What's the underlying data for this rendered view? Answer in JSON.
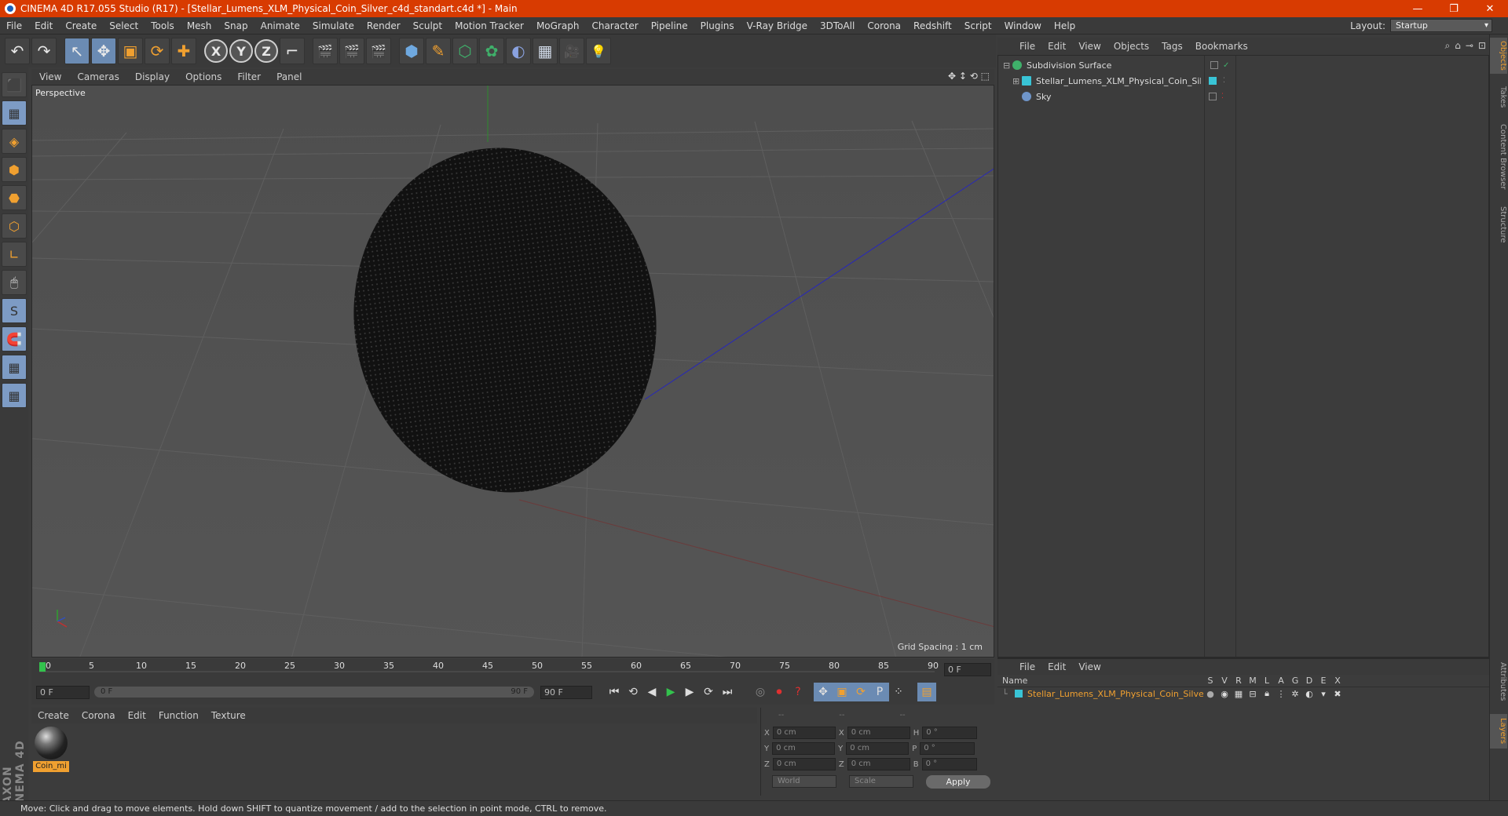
{
  "window": {
    "title": "CINEMA 4D R17.055 Studio (R17) - [Stellar_Lumens_XLM_Physical_Coin_Silver_c4d_standart.c4d *] - Main",
    "minimize": "—",
    "restore": "❐",
    "close": "✕"
  },
  "menubar": {
    "items": [
      "File",
      "Edit",
      "Create",
      "Select",
      "Tools",
      "Mesh",
      "Snap",
      "Animate",
      "Simulate",
      "Render",
      "Sculpt",
      "Motion Tracker",
      "MoGraph",
      "Character",
      "Pipeline",
      "Plugins",
      "V-Ray Bridge",
      "3DToAll",
      "Corona",
      "Redshift",
      "Script",
      "Window",
      "Help"
    ],
    "layout_label": "Layout:",
    "layout_value": "Startup"
  },
  "toolbar": {
    "undo": "↶",
    "redo": "↷",
    "select": "↖",
    "move": "✥",
    "scale": "▣",
    "rotate": "⟳",
    "live": "✚",
    "x_axis": "X",
    "y_axis": "Y",
    "z_axis": "Z",
    "coord": "⌐",
    "render_view": "🎬",
    "render_pic": "🎬",
    "render_settings": "🎬",
    "cube": "⬢",
    "pen": "✎",
    "subdiv": "⬡",
    "cloner": "✿",
    "deformer": "◐",
    "floor": "▦",
    "camera": "🎥",
    "light": "💡"
  },
  "lefttools": [
    "⬛",
    "▦",
    "◈",
    "⬢",
    "⬣",
    "⬡",
    "∟",
    "🖱",
    "S",
    "🧲",
    "▦",
    "▦"
  ],
  "viewport": {
    "menu": [
      "View",
      "Cameras",
      "Display",
      "Options",
      "Filter",
      "Panel"
    ],
    "nav": "✥ ↕ ⟲ ⬚",
    "label": "Perspective",
    "grid_spacing": "Grid Spacing : 1 cm"
  },
  "timeline": {
    "ticks": [
      "0",
      "5",
      "10",
      "15",
      "20",
      "25",
      "30",
      "35",
      "40",
      "45",
      "50",
      "55",
      "60",
      "65",
      "70",
      "75",
      "80",
      "85",
      "90"
    ],
    "current_frame": "0 F",
    "start_field": "0 F",
    "range_start": "0 F",
    "range_end": "90 F",
    "end_field": "90 F"
  },
  "transport": {
    "first": "⏮",
    "prev_key": "⟲",
    "prev": "◀",
    "play": "▶",
    "next": "▶",
    "next_key": "⟳",
    "last": "⏭"
  },
  "materials": {
    "menu": [
      "Create",
      "Corona",
      "Edit",
      "Function",
      "Texture"
    ],
    "items": [
      {
        "label": "Coin_mi"
      }
    ]
  },
  "coordinates": {
    "header": [
      "--",
      "--",
      "--"
    ],
    "rows": [
      {
        "a": "X",
        "av": "0 cm",
        "b": "X",
        "bv": "0 cm",
        "c": "H",
        "cv": "0 °"
      },
      {
        "a": "Y",
        "av": "0 cm",
        "b": "Y",
        "bv": "0 cm",
        "c": "P",
        "cv": "0 °"
      },
      {
        "a": "Z",
        "av": "0 cm",
        "b": "Z",
        "bv": "0 cm",
        "c": "B",
        "cv": "0 °"
      }
    ],
    "mode1": "World",
    "mode2": "Scale",
    "apply": "Apply"
  },
  "objects": {
    "menu": [
      "File",
      "Edit",
      "View",
      "Objects",
      "Tags",
      "Bookmarks"
    ],
    "tree": [
      {
        "name": "Subdivision Surface",
        "icon_color": "#3fb06a"
      },
      {
        "name": "Stellar_Lumens_XLM_Physical_Coin_Silver",
        "icon_color": "#39c4d6"
      },
      {
        "name": "Sky",
        "icon_color": "#6f95c9"
      }
    ]
  },
  "layers": {
    "menu": [
      "File",
      "Edit",
      "View"
    ],
    "columns": [
      "Name",
      "S",
      "V",
      "R",
      "M",
      "L",
      "A",
      "G",
      "D",
      "E",
      "X"
    ],
    "rows": [
      {
        "name": "Stellar_Lumens_XLM_Physical_Coin_Silver"
      }
    ]
  },
  "sidetabs": [
    "Objects",
    "Takes",
    "Content Browser",
    "Structure",
    "Attributes",
    "Layers"
  ],
  "status": {
    "text": "Move: Click and drag to move elements. Hold down SHIFT to quantize movement / add to the selection in point mode, CTRL to remove."
  },
  "colors": {
    "titlebar": "#d83b01",
    "accent": "#f0a030",
    "highlight": "#6b8bb3"
  }
}
